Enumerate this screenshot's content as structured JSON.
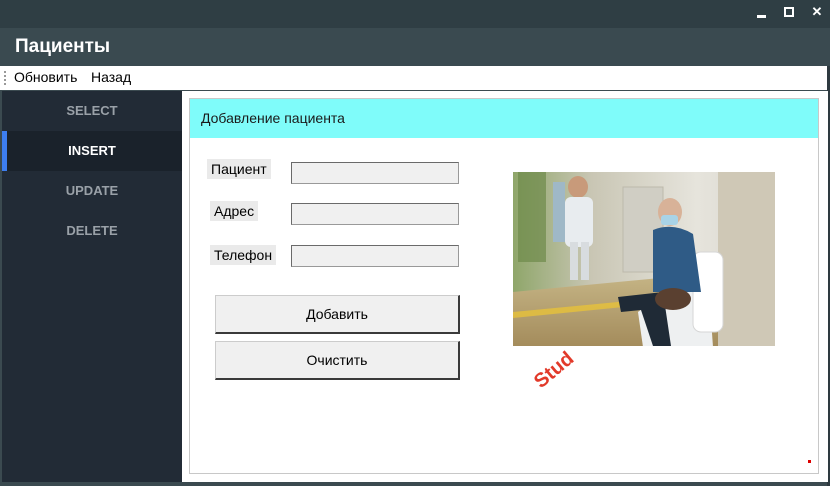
{
  "window": {
    "title": "Пациенты"
  },
  "menu": {
    "items": [
      "Обновить",
      "Назад"
    ]
  },
  "sidebar": {
    "items": [
      {
        "label": "SELECT",
        "active": false
      },
      {
        "label": "INSERT",
        "active": true
      },
      {
        "label": "UPDATE",
        "active": false
      },
      {
        "label": "DELETE",
        "active": false
      }
    ]
  },
  "form": {
    "header": "Добавление пациента",
    "fields": [
      {
        "label": "Пациент",
        "value": ""
      },
      {
        "label": "Адрес",
        "value": ""
      },
      {
        "label": "Телефон",
        "value": ""
      }
    ],
    "add_button": "Добавить",
    "clear_button": "Очистить"
  },
  "photo": {
    "subject": "elderly man in mask sitting in hospital corridor"
  },
  "watermark": {
    "text": "Stud"
  },
  "colors": {
    "header_accent": "#7ffcfa",
    "sidebar_bg": "#222b36",
    "active_marker": "#3d7ef0",
    "titlebar_bg": "#3a4a50"
  }
}
